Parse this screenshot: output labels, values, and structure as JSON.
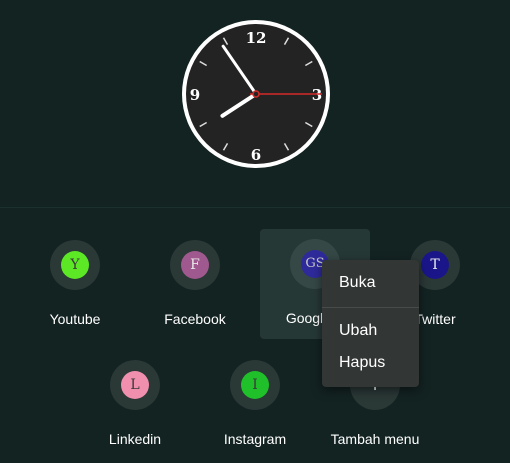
{
  "clock": {
    "numerals": {
      "twelve": "12",
      "three": "3",
      "six": "6",
      "nine": "9"
    },
    "time": {
      "hours": 7,
      "minutes": 54,
      "seconds": 15
    },
    "colors": {
      "face": "#232323",
      "rim": "#ffffff",
      "second_hand": "#d42b2b"
    }
  },
  "shortcuts": [
    {
      "label": "Youtube",
      "letter": "Y",
      "color": "#5de825",
      "letter_color": "#3a3a3a"
    },
    {
      "label": "Facebook",
      "letter": "F",
      "color": "#a0598e",
      "letter_color": "#e8e8e8"
    },
    {
      "label": "Google S",
      "letter": "GS",
      "color": "#2e2a9a",
      "letter_color": "#c8c8c8"
    },
    {
      "label": "Twitter",
      "letter": "T",
      "color": "#1a168a",
      "letter_color": "#e8e8e8"
    },
    {
      "label": "Linkedin",
      "letter": "L",
      "color": "#f08fae",
      "letter_color": "#3a3a3a"
    },
    {
      "label": "Instagram",
      "letter": "I",
      "color": "#20c02a",
      "letter_color": "#3a3a3a"
    }
  ],
  "add_menu": {
    "label": "Tambah menu",
    "icon": "plus-icon"
  },
  "context_menu": {
    "open": "Buka",
    "edit": "Ubah",
    "delete": "Hapus"
  }
}
